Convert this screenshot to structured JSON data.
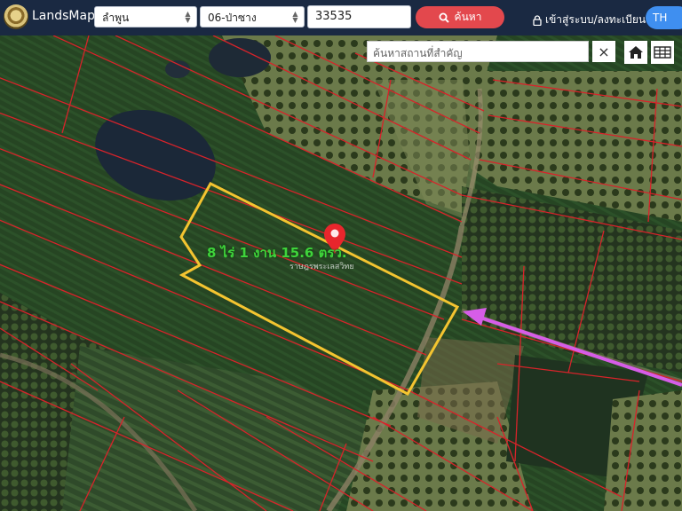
{
  "header": {
    "brand": "LandsMaps",
    "province": "ลำพูน",
    "district": "06-ป่าซาง",
    "parcel_number": "33535",
    "search_label": "ค้นหา",
    "login_label": "เข้าสู่ระบบ/ลงทะเบียน",
    "language": "TH"
  },
  "map": {
    "place_search_placeholder": "ค้นหาสถานที่สำคัญ",
    "clear_label": "×",
    "area_label": "8 ไร่ 1 งาน 15.6 ตรว.",
    "parcel_sublabel": "ราษฎรพระเลสวิทย",
    "colors": {
      "parcel_lines": "#d8232a",
      "selected_parcel": "#f4c430",
      "pin": "#e8262c",
      "arrow": "#d65de8",
      "area_text": "#3fd33b"
    }
  }
}
